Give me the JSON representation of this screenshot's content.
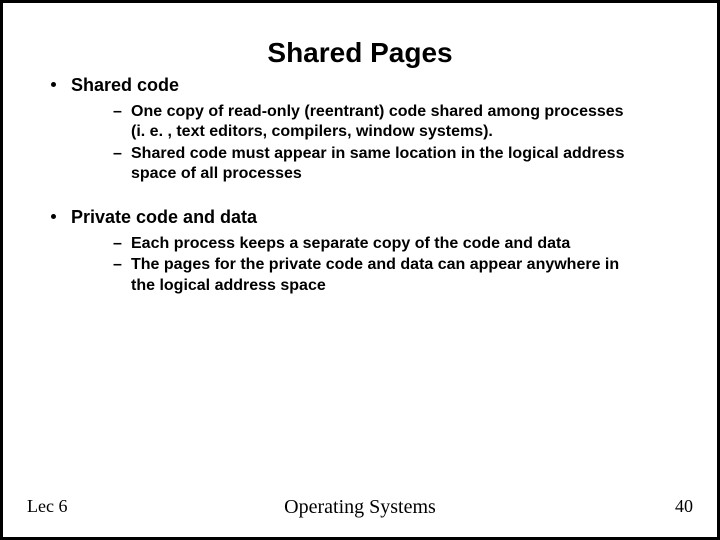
{
  "title": "Shared Pages",
  "bullets": [
    {
      "label": "Shared code",
      "subs": [
        "One copy of read-only (reentrant) code shared among processes (i. e. , text editors, compilers, window systems).",
        "Shared code must appear in same location in the logical address space of all processes"
      ]
    },
    {
      "label": "Private code and data",
      "subs": [
        "Each process keeps a separate copy of the code and data",
        "The pages for the private code and data can appear anywhere in the logical address space"
      ]
    }
  ],
  "footer": {
    "left": "Lec 6",
    "center": "Operating Systems",
    "right": "40"
  }
}
